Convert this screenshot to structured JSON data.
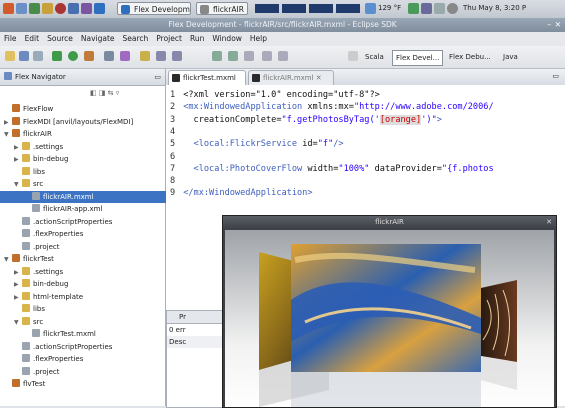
{
  "panel": {
    "tasks": [
      "Flex Developme...",
      "flickrAIR"
    ],
    "temperature": "129 °F",
    "clock": "Thu May 8,  3:20 P"
  },
  "window": {
    "title": "Flex Development - flickrAIR/src/flickrAIR.mxml - Eclipse SDK"
  },
  "menu": [
    "File",
    "Edit",
    "Source",
    "Navigate",
    "Search",
    "Project",
    "Run",
    "Window",
    "Help"
  ],
  "perspectives": [
    "Scala",
    "Flex Devel...",
    "Flex Debu...",
    "Java"
  ],
  "navigator": {
    "title": "Flex Navigator",
    "items": [
      {
        "label": "FlexFlow",
        "indent": 0,
        "type": "project",
        "twist": ""
      },
      {
        "label": "FlexMDI [anvil/layouts/FlexMDI]",
        "indent": 0,
        "type": "project",
        "twist": "▶"
      },
      {
        "label": "flickrAIR",
        "indent": 0,
        "type": "project",
        "twist": "▼"
      },
      {
        "label": ".settings",
        "indent": 1,
        "type": "folder",
        "twist": "▶"
      },
      {
        "label": "bin-debug",
        "indent": 1,
        "type": "folder",
        "twist": "▶"
      },
      {
        "label": "libs",
        "indent": 1,
        "type": "folder",
        "twist": ""
      },
      {
        "label": "src",
        "indent": 1,
        "type": "folder",
        "twist": "▼"
      },
      {
        "label": "flickrAIR.mxml",
        "indent": 2,
        "type": "file",
        "twist": "",
        "selected": true
      },
      {
        "label": "flickrAIR-app.xml",
        "indent": 2,
        "type": "file",
        "twist": ""
      },
      {
        "label": ".actionScriptProperties",
        "indent": 1,
        "type": "file",
        "twist": ""
      },
      {
        "label": ".flexProperties",
        "indent": 1,
        "type": "file",
        "twist": ""
      },
      {
        "label": ".project",
        "indent": 1,
        "type": "file",
        "twist": ""
      },
      {
        "label": "flickrTest",
        "indent": 0,
        "type": "project",
        "twist": "▼"
      },
      {
        "label": ".settings",
        "indent": 1,
        "type": "folder",
        "twist": "▶"
      },
      {
        "label": "bin-debug",
        "indent": 1,
        "type": "folder",
        "twist": "▶"
      },
      {
        "label": "html-template",
        "indent": 1,
        "type": "folder",
        "twist": "▶"
      },
      {
        "label": "libs",
        "indent": 1,
        "type": "folder",
        "twist": ""
      },
      {
        "label": "src",
        "indent": 1,
        "type": "folder",
        "twist": "▼"
      },
      {
        "label": "flickrTest.mxml",
        "indent": 2,
        "type": "file",
        "twist": ""
      },
      {
        "label": ".actionScriptProperties",
        "indent": 1,
        "type": "file",
        "twist": ""
      },
      {
        "label": ".flexProperties",
        "indent": 1,
        "type": "file",
        "twist": ""
      },
      {
        "label": ".project",
        "indent": 1,
        "type": "file",
        "twist": ""
      },
      {
        "label": "flvTest",
        "indent": 0,
        "type": "project",
        "twist": ""
      }
    ]
  },
  "editor": {
    "tabs": [
      "flickrTest.mxml",
      "flickrAIR.mxml"
    ],
    "lines": [
      {
        "n": "1",
        "parts": [
          {
            "t": "<?xml version=\"1.0\" encoding=\"utf-8\"?>",
            "c": ""
          }
        ]
      },
      {
        "n": "2",
        "parts": [
          {
            "t": "<mx:WindowedApplication",
            "c": "tag"
          },
          {
            "t": " xmlns:mx=",
            "c": ""
          },
          {
            "t": "\"http://www.adobe.com/2006/",
            "c": "str"
          }
        ]
      },
      {
        "n": "3",
        "parts": [
          {
            "t": "  creationComplete=",
            "c": ""
          },
          {
            "t": "\"f.getPhotosByTag('",
            "c": "str"
          },
          {
            "t": "[orange]",
            "c": "hl"
          },
          {
            "t": "')\"",
            "c": "str"
          },
          {
            "t": ">",
            "c": "tag"
          }
        ]
      },
      {
        "n": "4",
        "parts": []
      },
      {
        "n": "5",
        "parts": [
          {
            "t": "  <local:FlickrService",
            "c": "tag"
          },
          {
            "t": " id=",
            "c": ""
          },
          {
            "t": "\"f\"",
            "c": "str"
          },
          {
            "t": "/>",
            "c": "tag"
          }
        ]
      },
      {
        "n": "6",
        "parts": []
      },
      {
        "n": "7",
        "parts": [
          {
            "t": "  <local:PhotoCoverFlow",
            "c": "tag"
          },
          {
            "t": " width=",
            "c": ""
          },
          {
            "t": "\"100%\"",
            "c": "str"
          },
          {
            "t": " dataProvider=",
            "c": ""
          },
          {
            "t": "\"{f.photos",
            "c": "str"
          }
        ]
      },
      {
        "n": "8",
        "parts": []
      },
      {
        "n": "9",
        "parts": [
          {
            "t": "</mx:WindowedApplication>",
            "c": "tag"
          }
        ]
      }
    ]
  },
  "problems": {
    "tab": "Pr",
    "count": "0 err",
    "col": "Desc"
  },
  "flickr_window": {
    "title": "flickrAIR"
  }
}
